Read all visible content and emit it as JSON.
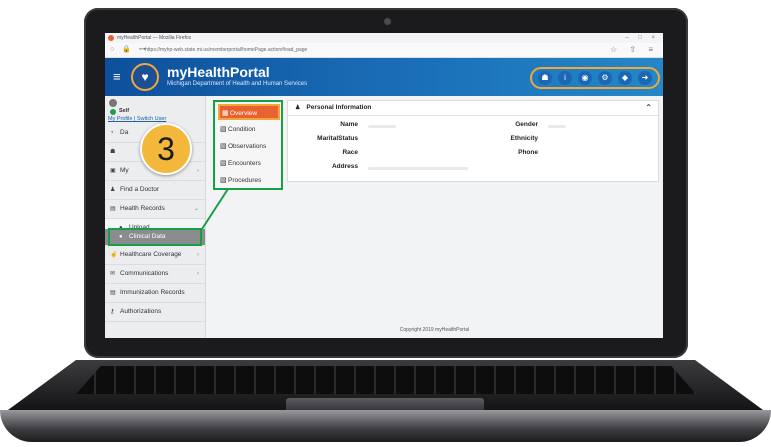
{
  "browser": {
    "tab_title": "myHealthPortal — Mozilla Firefox",
    "url": "https://myhp-web.state.mi.us/memberportal/homePage.action#load_page",
    "nav_icons": "○ 🔒 ⊶",
    "right_icons": "☆ ⇧ ≡",
    "window_controls": "– □ ×"
  },
  "header": {
    "menu_icon": "≡",
    "logo_glyph": "♥",
    "title": "myHealthPortal",
    "subtitle": "Michigan Department of Health and Human Services",
    "actions": [
      {
        "icon": "people-icon",
        "glyph": "☗"
      },
      {
        "icon": "info-icon",
        "glyph": "i"
      },
      {
        "icon": "globe-icon",
        "glyph": "◉"
      },
      {
        "icon": "settings-icon",
        "glyph": "⚙"
      },
      {
        "icon": "bell-icon",
        "glyph": "◆"
      },
      {
        "icon": "logout-icon",
        "glyph": "➜"
      }
    ],
    "accent_color": "#f2a63b"
  },
  "sidebar": {
    "self_label": "Self",
    "profile_links": "My Profile | Switch User",
    "items": [
      {
        "label": "Da",
        "icon": "dashboard-icon",
        "glyph": "◔"
      },
      {
        "label": "",
        "icon": "people-icon",
        "glyph": "☗"
      },
      {
        "label": "My",
        "icon": "calendar-icon",
        "glyph": "▣",
        "chevron": "›"
      },
      {
        "label": "Find a Doctor",
        "icon": "user-icon",
        "glyph": "♟"
      },
      {
        "label": "Health Records",
        "icon": "records-icon",
        "glyph": "▤",
        "chevron": "⌄"
      },
      {
        "label": "Upload",
        "icon": "upload-icon",
        "glyph": "●"
      },
      {
        "label": "Clinical Data",
        "icon": "clinical-icon",
        "glyph": "●"
      },
      {
        "label": "Healthcare Coverage",
        "icon": "thumbs-up-icon",
        "glyph": "☝",
        "chevron": "›"
      },
      {
        "label": "Communications",
        "icon": "chat-icon",
        "glyph": "✉",
        "chevron": "›"
      },
      {
        "label": "Immunization Records",
        "icon": "document-icon",
        "glyph": "▤"
      },
      {
        "label": "Authorizations",
        "icon": "key-icon",
        "glyph": "⚷"
      }
    ]
  },
  "step_badge": "3",
  "tabs": [
    {
      "label": "Overview",
      "icon": "overview-icon",
      "glyph": "▦"
    },
    {
      "label": "Condition",
      "icon": "condition-icon",
      "glyph": "▧"
    },
    {
      "label": "Observations",
      "icon": "observations-icon",
      "glyph": "▧"
    },
    {
      "label": "Encounters",
      "icon": "encounters-icon",
      "glyph": "▧"
    },
    {
      "label": "Procedures",
      "icon": "procedures-icon",
      "glyph": "▧"
    }
  ],
  "personal_info": {
    "title": "Personal Information",
    "icon_glyph": "♟",
    "caret": "⌃",
    "left_fields": [
      "Name",
      "MaritalStatus",
      "Race",
      "Address"
    ],
    "right_fields": [
      "Gender",
      "Ethnicity",
      "Phone"
    ]
  },
  "footer": "Copyright 2019 myHealthPortal",
  "highlight_color": "#16a044"
}
